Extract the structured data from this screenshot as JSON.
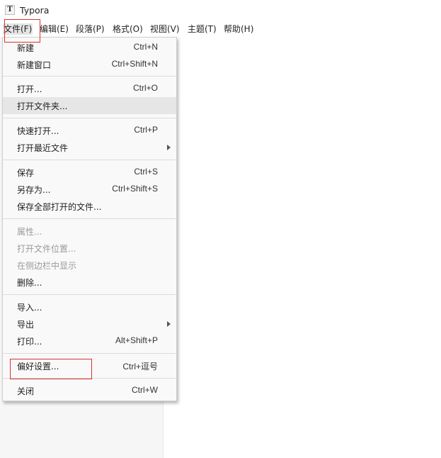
{
  "app": {
    "icon_glyph": "T",
    "title": "Typora"
  },
  "menubar": {
    "items": [
      {
        "label": "文件(F)",
        "active": true
      },
      {
        "label": "编辑(E)"
      },
      {
        "label": "段落(P)"
      },
      {
        "label": "格式(O)"
      },
      {
        "label": "视图(V)"
      },
      {
        "label": "主题(T)"
      },
      {
        "label": "帮助(H)"
      }
    ]
  },
  "file_menu": {
    "items": [
      {
        "label": "新建",
        "shortcut": "Ctrl+N"
      },
      {
        "label": "新建窗口",
        "shortcut": "Ctrl+Shift+N"
      },
      {
        "label": "打开...",
        "shortcut": "Ctrl+O"
      },
      {
        "label": "打开文件夹...",
        "shortcut": "",
        "hover": true
      },
      {
        "label": "快速打开...",
        "shortcut": "Ctrl+P"
      },
      {
        "label": "打开最近文件",
        "shortcut": "",
        "submenu": true
      },
      {
        "label": "保存",
        "shortcut": "Ctrl+S"
      },
      {
        "label": "另存为...",
        "shortcut": "Ctrl+Shift+S"
      },
      {
        "label": "保存全部打开的文件...",
        "shortcut": ""
      },
      {
        "label": "属性...",
        "shortcut": "",
        "disabled": true
      },
      {
        "label": "打开文件位置...",
        "shortcut": "",
        "disabled": true
      },
      {
        "label": "在侧边栏中显示",
        "shortcut": "",
        "disabled": true
      },
      {
        "label": "删除...",
        "shortcut": ""
      },
      {
        "label": "导入...",
        "shortcut": ""
      },
      {
        "label": "导出",
        "shortcut": "",
        "submenu": true
      },
      {
        "label": "打印...",
        "shortcut": "Alt+Shift+P"
      },
      {
        "label": "偏好设置...",
        "shortcut": "Ctrl+逗号"
      },
      {
        "label": "关闭",
        "shortcut": "Ctrl+W"
      }
    ]
  },
  "highlight_color": "#e03030"
}
